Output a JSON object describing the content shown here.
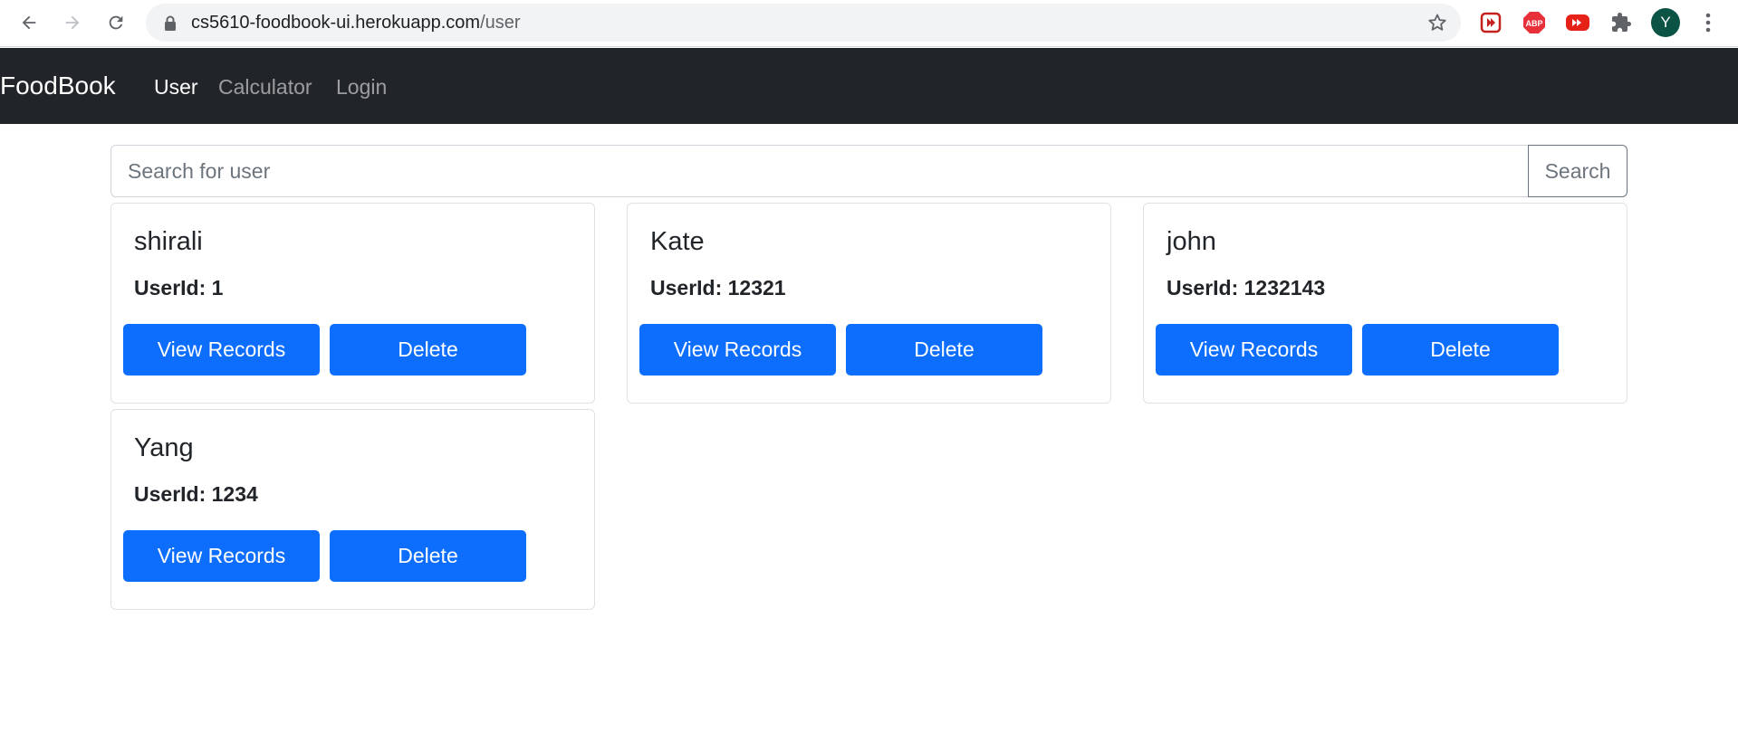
{
  "browser": {
    "url_host": "cs5610-foodbook-ui.herokuapp.com",
    "url_path": "/user",
    "profile_initial": "Y",
    "icons": [
      "back-arrow-icon",
      "forward-arrow-icon",
      "reload-icon",
      "lock-icon",
      "star-icon",
      "video-extension-icon",
      "adblock-extension-icon",
      "youtube-extension-icon",
      "puzzle-extensions-icon",
      "kebab-menu-icon"
    ],
    "abp_label": "ABP"
  },
  "navbar": {
    "brand": "FoodBook",
    "links": [
      {
        "label": "User",
        "active": true
      },
      {
        "label": "Calculator",
        "active": false
      },
      {
        "label": "Login",
        "active": false
      }
    ]
  },
  "search": {
    "placeholder": "Search for user",
    "value": "",
    "button_label": "Search"
  },
  "users": [
    {
      "name": "shirali",
      "userid_text": "UserId: 1",
      "view_label": "View Records",
      "delete_label": "Delete"
    },
    {
      "name": "Kate",
      "userid_text": "UserId: 12321",
      "view_label": "View Records",
      "delete_label": "Delete"
    },
    {
      "name": "john",
      "userid_text": "UserId: 1232143",
      "view_label": "View Records",
      "delete_label": "Delete"
    },
    {
      "name": "Yang",
      "userid_text": "UserId: 1234",
      "view_label": "View Records",
      "delete_label": "Delete"
    }
  ],
  "colors": {
    "navbar_bg": "#212529",
    "primary_button": "#0d6efd",
    "avatar_bg": "#0b5345"
  }
}
